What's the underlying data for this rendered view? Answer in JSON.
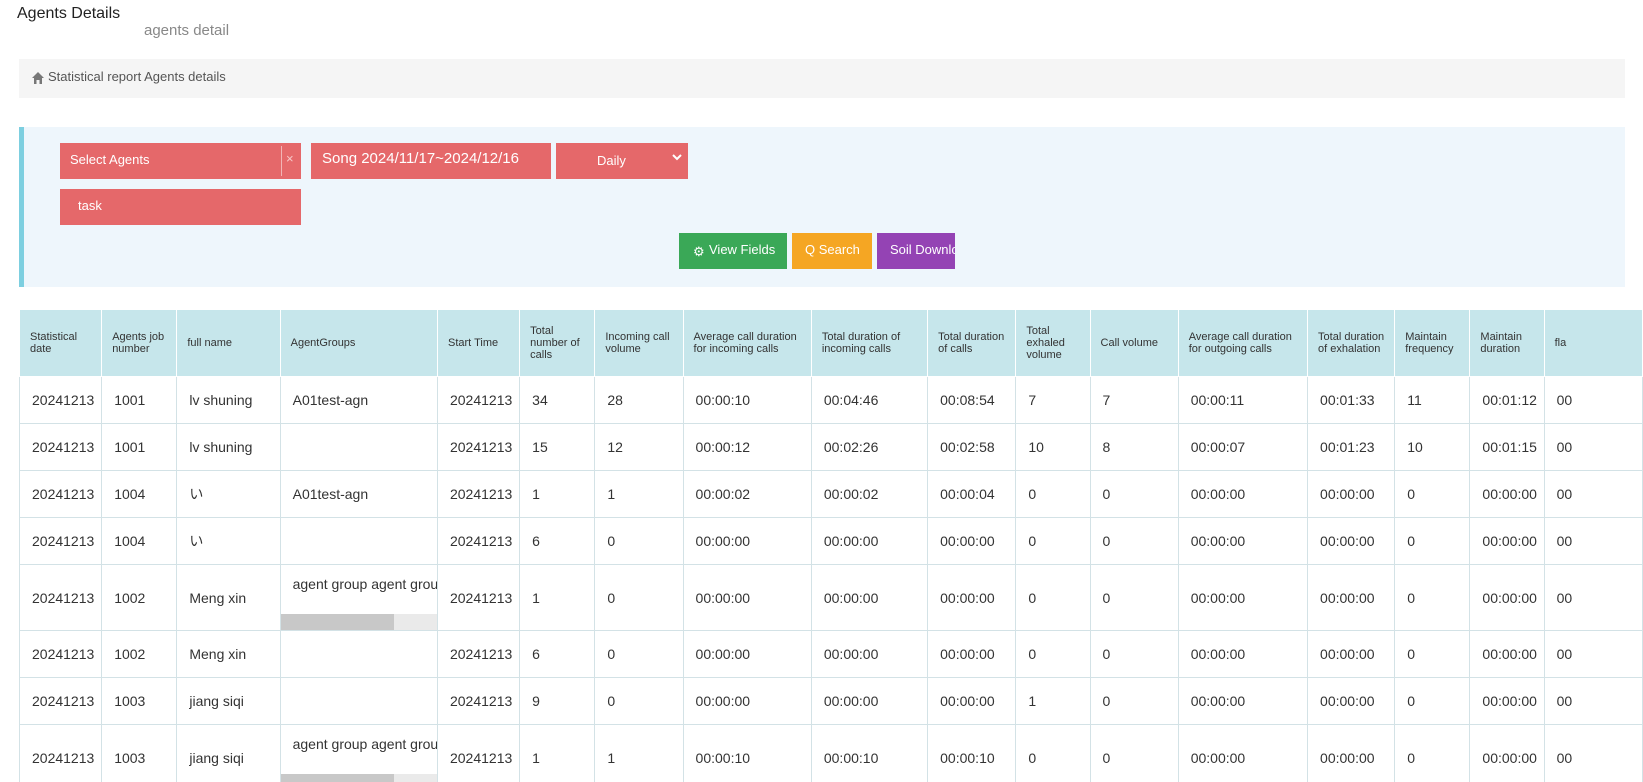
{
  "header": {
    "title": "Agents Details",
    "subtitle": "agents detail"
  },
  "breadcrumb": {
    "icon": "home-icon",
    "text": "Statistical report Agents details"
  },
  "filters": {
    "agents_placeholder": "Select Agents",
    "agents_clear": "×",
    "date_range": "Song 2024/11/17~2024/12/16",
    "period": "Daily",
    "task_placeholder": "task"
  },
  "buttons": {
    "view_fields": "View Fields",
    "search": "Q Search",
    "download": "Soil Downlo"
  },
  "colors": {
    "filter_red": "#e5686a",
    "view_green": "#3aa857",
    "search_orange": "#f5a623",
    "download_purple": "#9443b4",
    "header_teal": "#c6e6eb"
  },
  "table": {
    "columns": [
      "Statistical date",
      "Agents job number",
      "full name",
      "AgentGroups",
      "Start Time",
      "Total number of calls",
      "Incoming call volume",
      "Average call duration for incoming calls",
      "Total duration of incoming calls",
      "Total duration of calls",
      "Total exhaled volume",
      "Call volume",
      "Average call duration for outgoing calls",
      "Total duration of exhalation",
      "Maintain frequency",
      "Maintain duration",
      "fla"
    ],
    "rows": [
      [
        "20241213",
        "1001",
        "lv shuning",
        "A01test-agn",
        "20241213",
        "34",
        "28",
        "00:00:10",
        "00:04:46",
        "00:08:54",
        "7",
        "7",
        "00:00:11",
        "00:01:33",
        "11",
        "00:01:12",
        "00"
      ],
      [
        "20241213",
        "1001",
        "lv shuning",
        "",
        "20241213",
        "15",
        "12",
        "00:00:12",
        "00:02:26",
        "00:02:58",
        "10",
        "8",
        "00:00:07",
        "00:01:23",
        "10",
        "00:01:15",
        "00"
      ],
      [
        "20241213",
        "1004",
        "い",
        "A01test-agn",
        "20241213",
        "1",
        "1",
        "00:00:02",
        "00:00:02",
        "00:00:04",
        "0",
        "0",
        "00:00:00",
        "00:00:00",
        "0",
        "00:00:00",
        "00"
      ],
      [
        "20241213",
        "1004",
        "い",
        "",
        "20241213",
        "6",
        "0",
        "00:00:00",
        "00:00:00",
        "00:00:00",
        "0",
        "0",
        "00:00:00",
        "00:00:00",
        "0",
        "00:00:00",
        "00"
      ],
      [
        "20241213",
        "1002",
        "Meng xin",
        "agent group agent group",
        "20241213",
        "1",
        "0",
        "00:00:00",
        "00:00:00",
        "00:00:00",
        "0",
        "0",
        "00:00:00",
        "00:00:00",
        "0",
        "00:00:00",
        "00"
      ],
      [
        "20241213",
        "1002",
        "Meng xin",
        "",
        "20241213",
        "6",
        "0",
        "00:00:00",
        "00:00:00",
        "00:00:00",
        "0",
        "0",
        "00:00:00",
        "00:00:00",
        "0",
        "00:00:00",
        "00"
      ],
      [
        "20241213",
        "1003",
        "jiang siqi",
        "",
        "20241213",
        "9",
        "0",
        "00:00:00",
        "00:00:00",
        "00:00:00",
        "1",
        "0",
        "00:00:00",
        "00:00:00",
        "0",
        "00:00:00",
        "00"
      ],
      [
        "20241213",
        "1003",
        "jiang siqi",
        "agent group agent group",
        "20241213",
        "1",
        "1",
        "00:00:10",
        "00:00:10",
        "00:00:10",
        "0",
        "0",
        "00:00:00",
        "00:00:00",
        "0",
        "00:00:00",
        "00"
      ]
    ]
  }
}
